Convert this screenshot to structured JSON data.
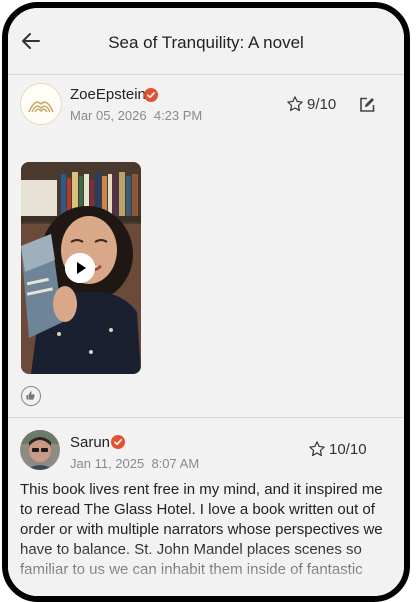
{
  "header": {
    "title": "Sea of Tranquility: A novel"
  },
  "posts": [
    {
      "username": "ZoeEpstein",
      "date": "Mar 05, 2026",
      "time": "4:23 PM",
      "rating": "9/10"
    },
    {
      "username": "Sarun",
      "date": "Jan 11, 2025",
      "time": "8:07 AM",
      "rating": "10/10",
      "text": "This book lives rent free in my mind, and it inspired me to reread The Glass Hotel. I love a book written out of order or with multiple narrators whose perspectives we have to balance. St. John Mandel places scenes so familiar to us we can inhabit them inside of fantastic"
    }
  ],
  "colors": {
    "verified": "#e2522f",
    "background": "#f2f2f2",
    "divider": "#d8d8d8"
  },
  "icons": [
    "back-arrow-icon",
    "verified-icon",
    "star-outline-icon",
    "edit-icon",
    "play-icon",
    "thumbs-up-icon"
  ]
}
